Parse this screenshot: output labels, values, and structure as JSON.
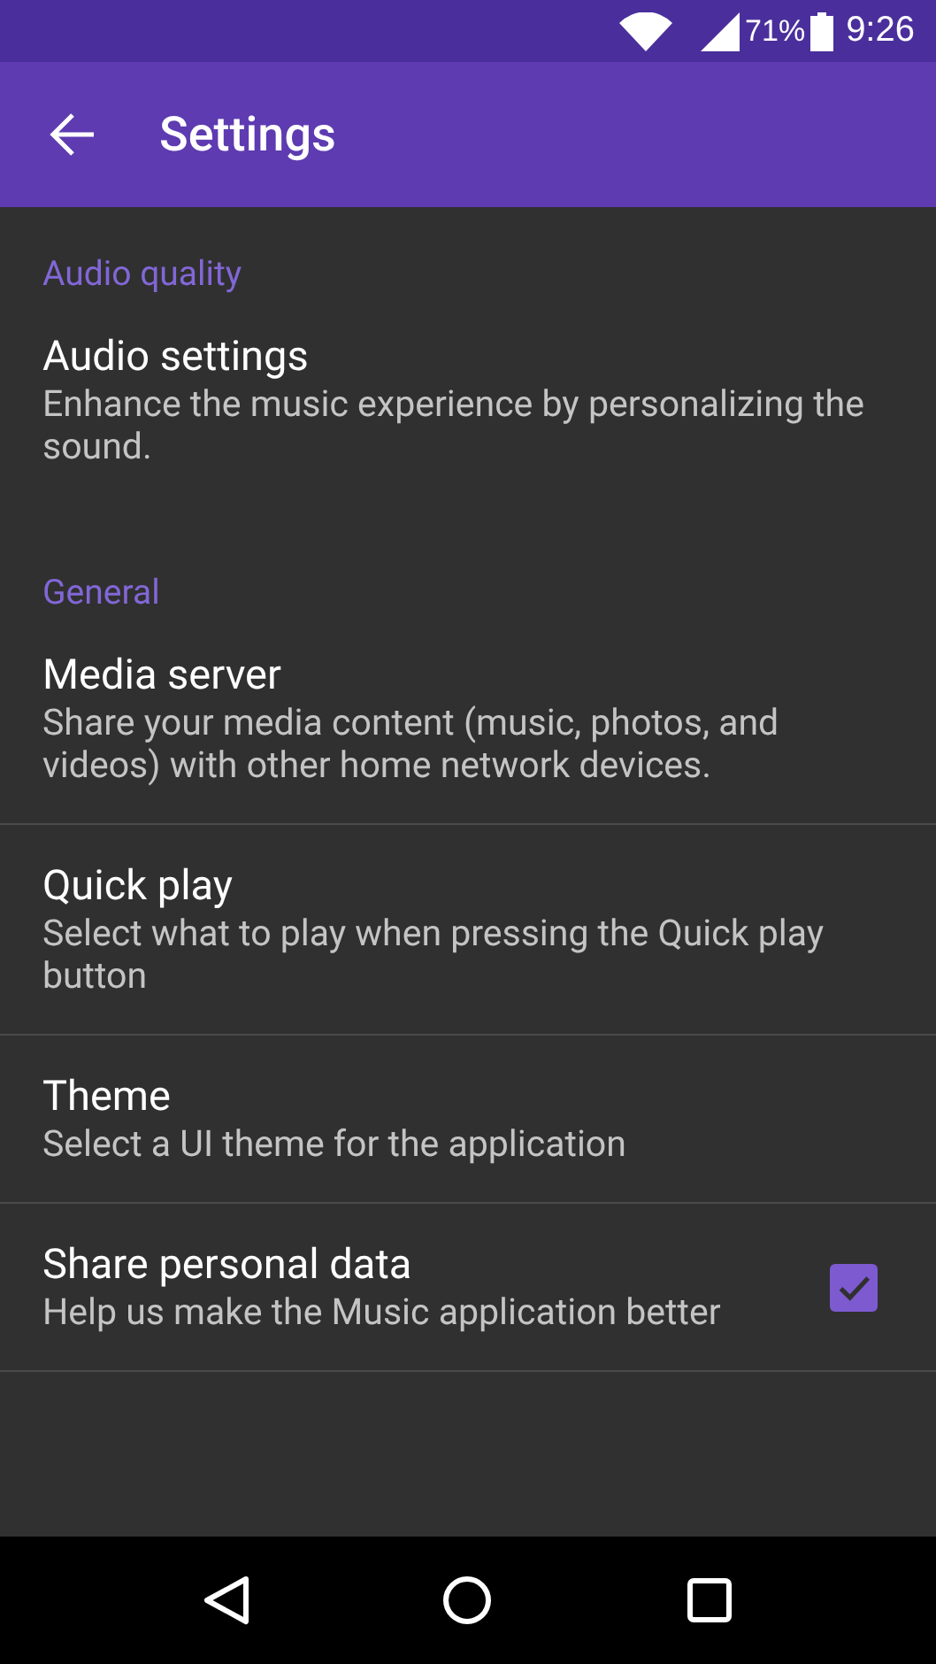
{
  "status_bar": {
    "battery": "71%",
    "time": "9:26"
  },
  "app_bar": {
    "title": "Settings"
  },
  "sections": [
    {
      "header": "Audio quality",
      "items": [
        {
          "kind": "plain",
          "title": "Audio settings",
          "summary": "Enhance the music experience by personalizing the sound."
        }
      ]
    },
    {
      "header": "General",
      "items": [
        {
          "kind": "plain",
          "title": "Media server",
          "summary": "Share your media content (music, photos, and videos) with other home network devices."
        },
        {
          "kind": "plain",
          "title": "Quick play",
          "summary": "Select what to play when pressing the Quick play button"
        },
        {
          "kind": "plain",
          "title": "Theme",
          "summary": "Select a UI theme for the application"
        },
        {
          "kind": "checkbox",
          "title": "Share personal data",
          "summary": "Help us make the Music application better",
          "checked": true
        }
      ]
    }
  ]
}
